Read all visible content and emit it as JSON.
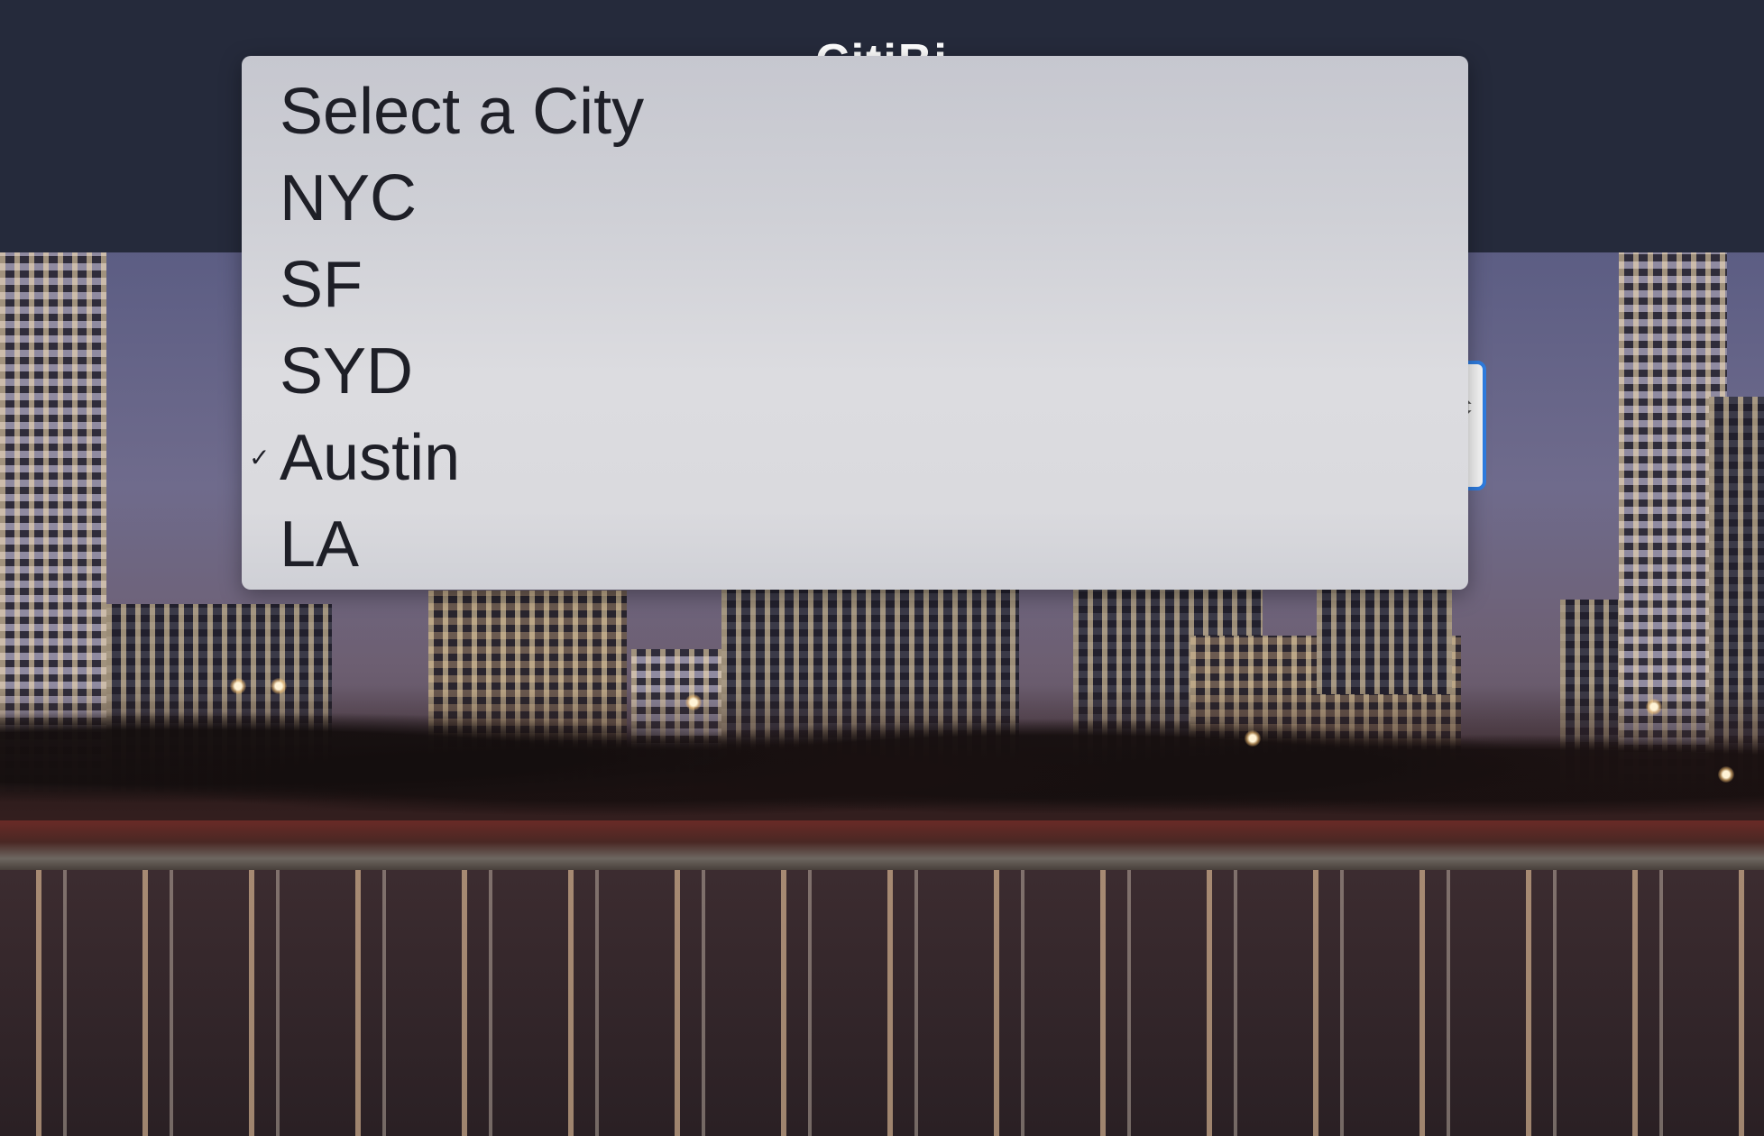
{
  "header": {
    "brand": "CitiBi"
  },
  "city_select": {
    "selected": "Austin",
    "options": [
      {
        "label": "Select a City",
        "checked": false
      },
      {
        "label": "NYC",
        "checked": false
      },
      {
        "label": "SF",
        "checked": false
      },
      {
        "label": "SYD",
        "checked": false
      },
      {
        "label": "Austin",
        "checked": true
      },
      {
        "label": "LA",
        "checked": false
      }
    ],
    "checkmark_glyph": "✓",
    "arrows_glyph": "⬍"
  },
  "colors": {
    "navbar": "#252a3b",
    "menu_text": "#1e1f27",
    "select_focus_ring": "#2f7de1"
  },
  "icons": {
    "checkmark": "checkmark-icon",
    "select_arrows": "updown-arrows-icon"
  }
}
